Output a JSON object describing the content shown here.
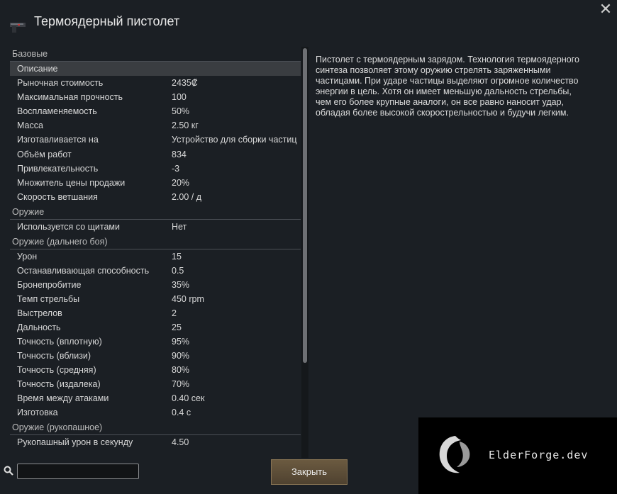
{
  "window": {
    "title": "Термоядерный пистолет",
    "close_glyph": "✕"
  },
  "sections": [
    {
      "header": "Базовые",
      "rows": [
        {
          "label": "Описание",
          "value": "",
          "selected": true
        },
        {
          "label": "Рыночная стоимость",
          "value": "2435₡"
        },
        {
          "label": "Максимальная прочность",
          "value": "100"
        },
        {
          "label": "Воспламеняемость",
          "value": "50%"
        },
        {
          "label": "Масса",
          "value": "2.50 кг"
        },
        {
          "label": "Изготавливается на",
          "value": "Устройство для сборки частиц"
        },
        {
          "label": "Объём работ",
          "value": "834"
        },
        {
          "label": "Привлекательность",
          "value": "-3"
        },
        {
          "label": "Множитель цены продажи",
          "value": "20%"
        },
        {
          "label": "Скорость ветшания",
          "value": "2.00 / д"
        }
      ]
    },
    {
      "header": "Оружие",
      "rows": [
        {
          "label": "Используется со щитами",
          "value": "Нет"
        }
      ]
    },
    {
      "header": "Оружие (дальнего боя)",
      "rows": [
        {
          "label": "Урон",
          "value": "15"
        },
        {
          "label": "Останавливающая способность",
          "value": "0.5"
        },
        {
          "label": "Бронепробитие",
          "value": "35%"
        },
        {
          "label": "Темп стрельбы",
          "value": "450 rpm"
        },
        {
          "label": "Выстрелов",
          "value": "2"
        },
        {
          "label": "Дальность",
          "value": "25"
        },
        {
          "label": "Точность (вплотную)",
          "value": "95%"
        },
        {
          "label": "Точность (вблизи)",
          "value": "90%"
        },
        {
          "label": "Точность (средняя)",
          "value": "80%"
        },
        {
          "label": "Точность (издалека)",
          "value": "70%"
        },
        {
          "label": "Время между атаками",
          "value": "0.40 сек"
        },
        {
          "label": "Изготовка",
          "value": "0.4 с"
        }
      ]
    },
    {
      "header": "Оружие (рукопашное)",
      "rows": [
        {
          "label": "Рукопашный урон в секунду",
          "value": "4.50"
        }
      ]
    }
  ],
  "description": "Пистолет с термоядерным зарядом. Технология термоядерного синтеза позволяет этому оружию стрелять заряженными частицами. При ударе частицы выделяют огромное количество энергии в цель. Хотя он имеет меньшую дальность стрельбы, чем его более крупные аналоги, он все равно наносит удар, обладая более высокой скорострельностью и будучи легким.",
  "search": {
    "placeholder": "",
    "value": ""
  },
  "buttons": {
    "close_label": "Закрыть"
  },
  "watermark": {
    "text": "ElderForge.dev"
  },
  "scroll": {
    "thumb_fraction": 0.77
  },
  "colors": {
    "panel": "#1b1f24",
    "selected_row": "#3a3d41",
    "button": "#5e4f38"
  }
}
